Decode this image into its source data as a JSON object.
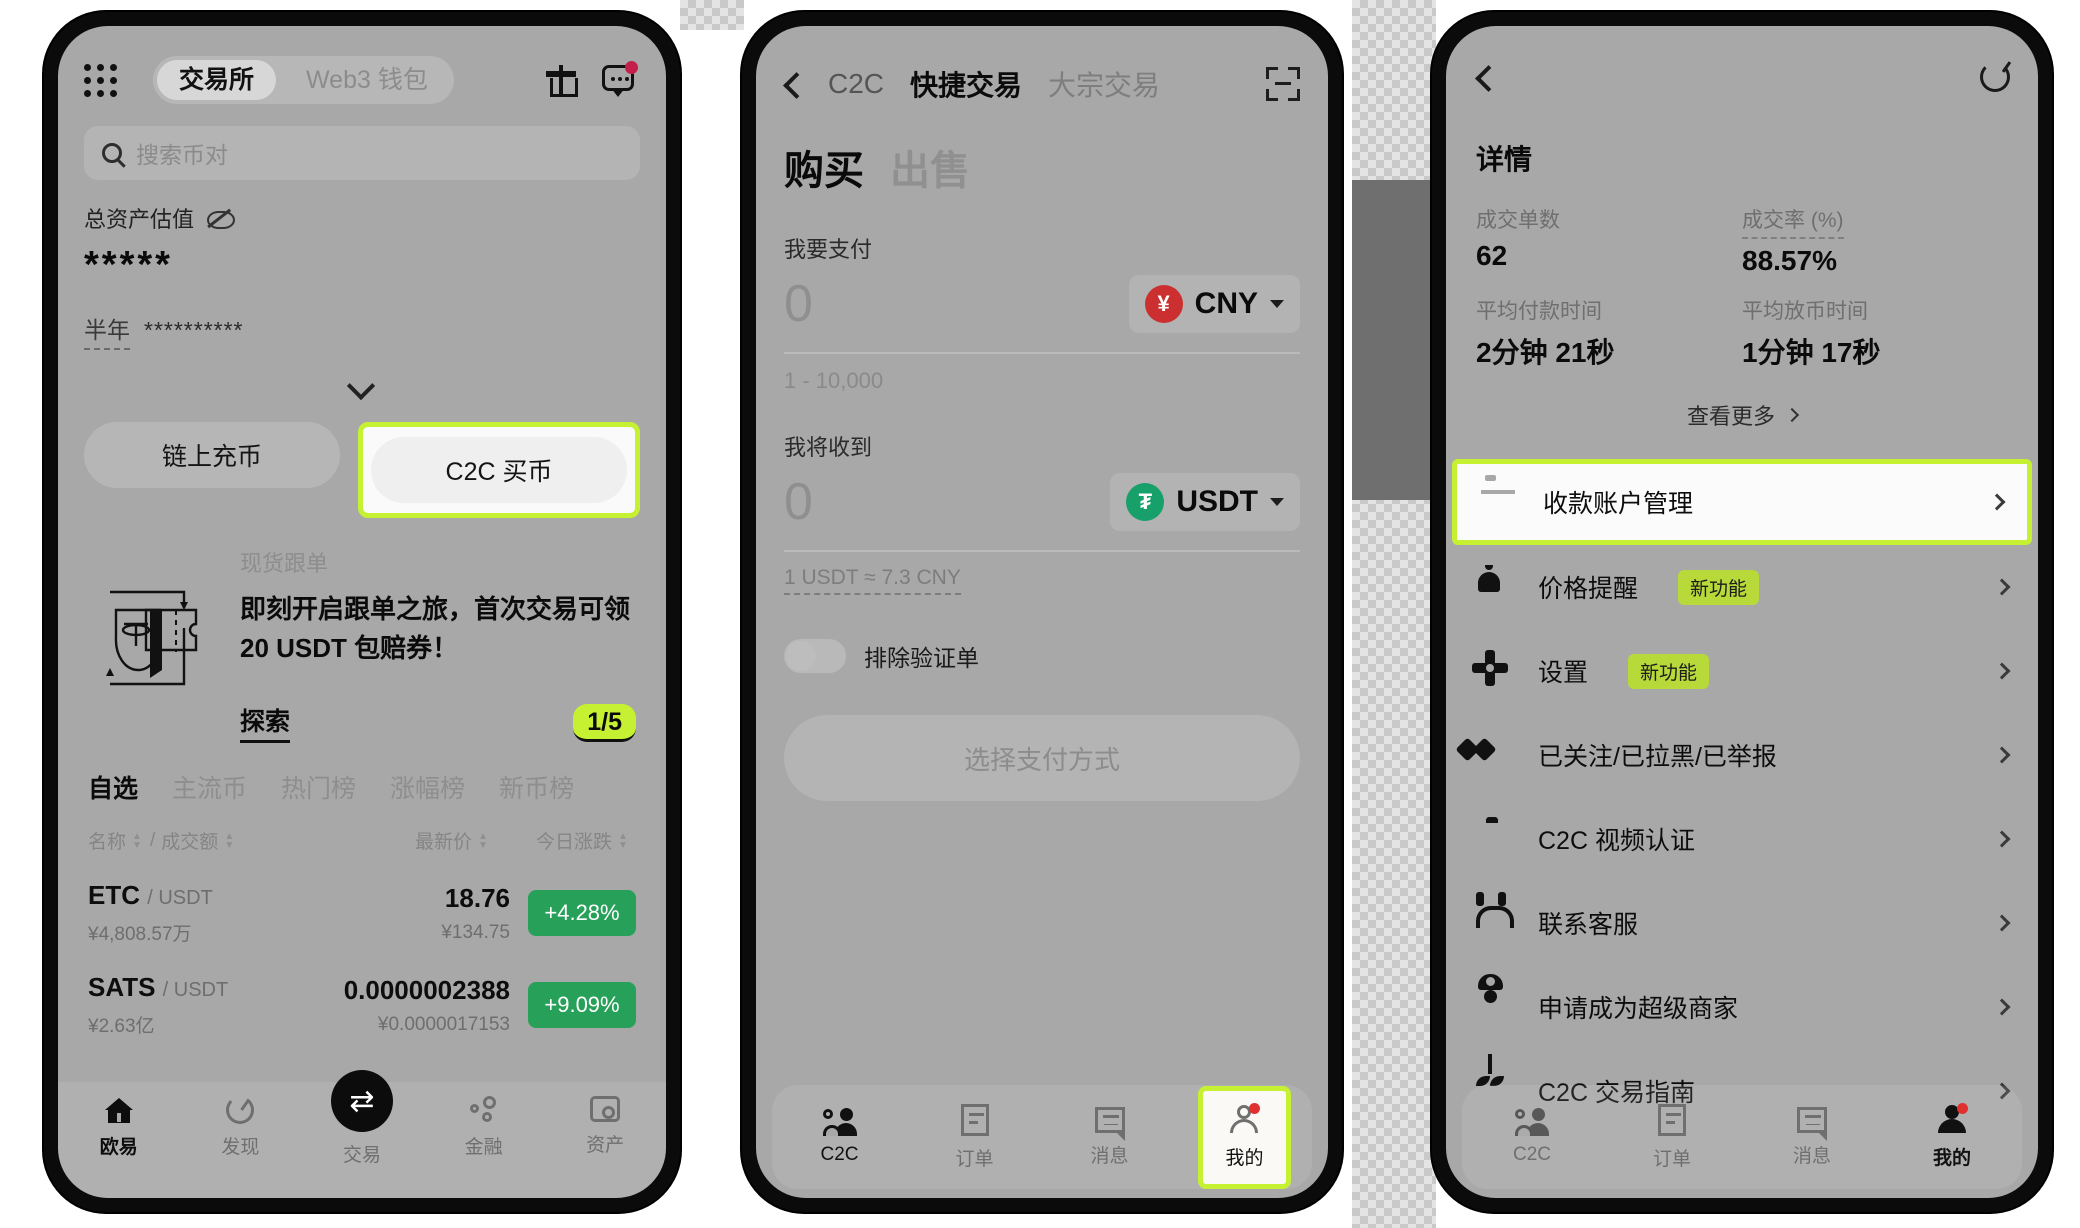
{
  "phone1": {
    "segments": [
      {
        "label": "交易所",
        "active": true
      },
      {
        "label": "Web3 钱包",
        "active": false
      }
    ],
    "search_placeholder": "搜索币对",
    "assets": {
      "label": "总资产估值",
      "value": "*****",
      "period": "半年",
      "period_value": "**********"
    },
    "actions": {
      "onchain_deposit": "链上充币",
      "c2c_buy": "C2C 买币"
    },
    "promo": {
      "kicker": "现货跟单",
      "title": "即刻开启跟单之旅，首次交易可领 20 USDT 包赔券！",
      "link": "探索",
      "counter": "1/5"
    },
    "market_tabs": [
      {
        "label": "自选",
        "active": true
      },
      {
        "label": "主流币",
        "active": false
      },
      {
        "label": "热门榜",
        "active": false
      },
      {
        "label": "涨幅榜",
        "active": false
      },
      {
        "label": "新币榜",
        "active": false
      }
    ],
    "table_headers": {
      "name": "名称",
      "separator": "/",
      "volume": "成交额",
      "price": "最新价",
      "change": "今日涨跌"
    },
    "coins": [
      {
        "symbol": "ETC",
        "pair": "/ USDT",
        "volume": "¥4,808.57万",
        "price": "18.76",
        "price_cny": "¥134.75",
        "change": "+4.28%"
      },
      {
        "symbol": "SATS",
        "pair": "/ USDT",
        "volume": "¥2.63亿",
        "price": "0.0000002388",
        "price_cny": "¥0.0000017153",
        "change": "+9.09%"
      }
    ],
    "nav": [
      {
        "label": "欧易",
        "icon": "home-icon",
        "active": true
      },
      {
        "label": "发现",
        "icon": "discover-icon",
        "active": false
      },
      {
        "label": "交易",
        "icon": "swap-icon",
        "active": false
      },
      {
        "label": "金融",
        "icon": "finance-icon",
        "active": false
      },
      {
        "label": "资产",
        "icon": "wallet-icon",
        "active": false
      }
    ]
  },
  "phone2": {
    "header_tabs": [
      {
        "label": "C2C",
        "active": false
      },
      {
        "label": "快捷交易",
        "active": true
      },
      {
        "label": "大宗交易",
        "active": false
      }
    ],
    "buy_sell": [
      {
        "label": "购买",
        "active": true
      },
      {
        "label": "出售",
        "active": false
      }
    ],
    "pay": {
      "label": "我要支付",
      "amount": "0",
      "currency": "CNY",
      "currency_symbol": "¥",
      "range_hint": "1 - 10,000"
    },
    "receive": {
      "label": "我将收到",
      "amount": "0",
      "currency": "USDT",
      "currency_symbol": "₮"
    },
    "rate": "1 USDT ≈ 7.3 CNY",
    "toggle_label": "排除验证单",
    "cta": "选择支付方式",
    "nav": [
      {
        "label": "C2C",
        "icon": "c2c-icon",
        "active": true
      },
      {
        "label": "订单",
        "icon": "order-icon",
        "active": false
      },
      {
        "label": "消息",
        "icon": "message-icon",
        "active": false
      },
      {
        "label": "我的",
        "icon": "profile-icon",
        "active": false,
        "highlighted": true,
        "badge": true
      }
    ]
  },
  "phone3": {
    "detail": {
      "title": "详情",
      "stats": [
        {
          "key": "成交单数",
          "value": "62",
          "dashed": false
        },
        {
          "key": "成交率 (%)",
          "value": "88.57%",
          "dashed": true
        },
        {
          "key": "平均付款时间",
          "value": "2分钟 21秒",
          "dashed": false
        },
        {
          "key": "平均放币时间",
          "value": "1分钟 17秒",
          "dashed": false
        }
      ],
      "more": "查看更多"
    },
    "menu": [
      {
        "label": "收款账户管理",
        "icon": "card-icon",
        "badge": null,
        "highlighted": true
      },
      {
        "label": "价格提醒",
        "icon": "bell-icon",
        "badge": "新功能",
        "highlighted": false
      },
      {
        "label": "设置",
        "icon": "gear-icon",
        "badge": "新功能",
        "highlighted": false
      },
      {
        "label": "已关注/已拉黑/已举报",
        "icon": "diamond-icon",
        "badge": null,
        "highlighted": false
      },
      {
        "label": "C2C 视频认证",
        "icon": "camera-icon",
        "badge": null,
        "highlighted": false
      },
      {
        "label": "联系客服",
        "icon": "headset-icon",
        "badge": null,
        "highlighted": false
      },
      {
        "label": "申请成为超级商家",
        "icon": "merchant-icon",
        "badge": null,
        "highlighted": false
      },
      {
        "label": "C2C 交易指南",
        "icon": "sprout-icon",
        "badge": null,
        "highlighted": false
      }
    ],
    "nav": [
      {
        "label": "C2C",
        "icon": "c2c-icon",
        "active": false
      },
      {
        "label": "订单",
        "icon": "order-icon",
        "active": false
      },
      {
        "label": "消息",
        "icon": "message-icon",
        "active": false
      },
      {
        "label": "我的",
        "icon": "profile-icon",
        "active": true,
        "badge": true
      }
    ]
  },
  "colors": {
    "highlight": "#c6f032",
    "badge_green": "#b7d93a",
    "positive_green": "#27a05a",
    "cny_red": "#cc2f2f",
    "usdt_green": "#17a06a"
  }
}
